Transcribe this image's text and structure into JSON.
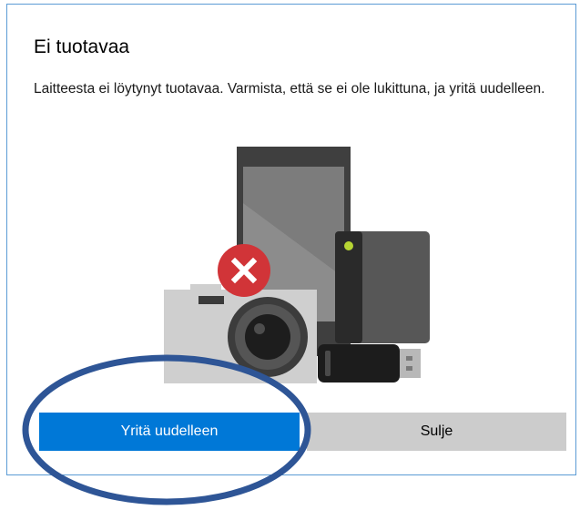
{
  "dialog": {
    "title": "Ei tuotavaa",
    "message": "Laitteesta ei löytynyt tuotavaa. Varmista, että se ei ole lukittuna, ja yritä uudelleen.",
    "retry_label": "Yritä uudelleen",
    "close_label": "Sulje"
  },
  "illustration": {
    "icons": [
      "phone-icon",
      "external-drive-icon",
      "camera-icon",
      "usb-stick-icon",
      "error-x-icon"
    ]
  },
  "colors": {
    "primary_button": "#0078d7",
    "secondary_button": "#cccccc",
    "error_badge": "#d13438",
    "dialog_border": "#5b9bd5",
    "annotation_ellipse": "#2e5596"
  }
}
